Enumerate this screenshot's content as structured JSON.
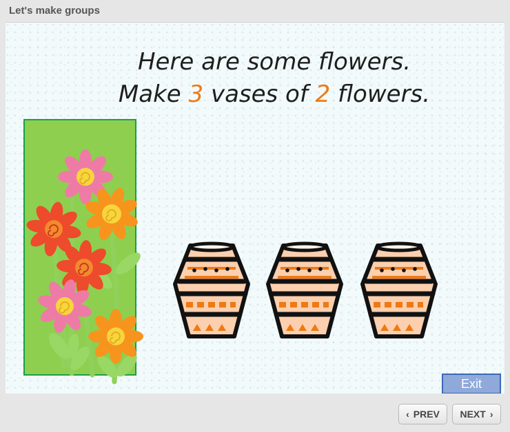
{
  "window": {
    "title": "Let's make groups"
  },
  "prompt": {
    "line1": "Here are some flowers.",
    "line2_prefix": "Make ",
    "vase_count": "3",
    "line2_middle": " vases of ",
    "flowers_per_vase": "2",
    "line2_suffix": " flowers."
  },
  "activity": {
    "flowers": [
      {
        "color": "pink"
      },
      {
        "color": "orange"
      },
      {
        "color": "red"
      },
      {
        "color": "red"
      },
      {
        "color": "pink"
      },
      {
        "color": "orange"
      }
    ],
    "vases": [
      {
        "state": "empty"
      },
      {
        "state": "empty"
      },
      {
        "state": "empty"
      }
    ]
  },
  "buttons": {
    "exit": "Exit",
    "prev": "PREV",
    "next": "NEXT"
  },
  "icons": {
    "prev": "chevron-left-icon",
    "next": "chevron-right-icon"
  },
  "colors": {
    "number_accent": "#ee7a14",
    "flower_box_fill": "#8ecf50",
    "flower_box_border": "#18a048",
    "exit_fill": "#8fa9da",
    "exit_border": "#3c68b6"
  }
}
